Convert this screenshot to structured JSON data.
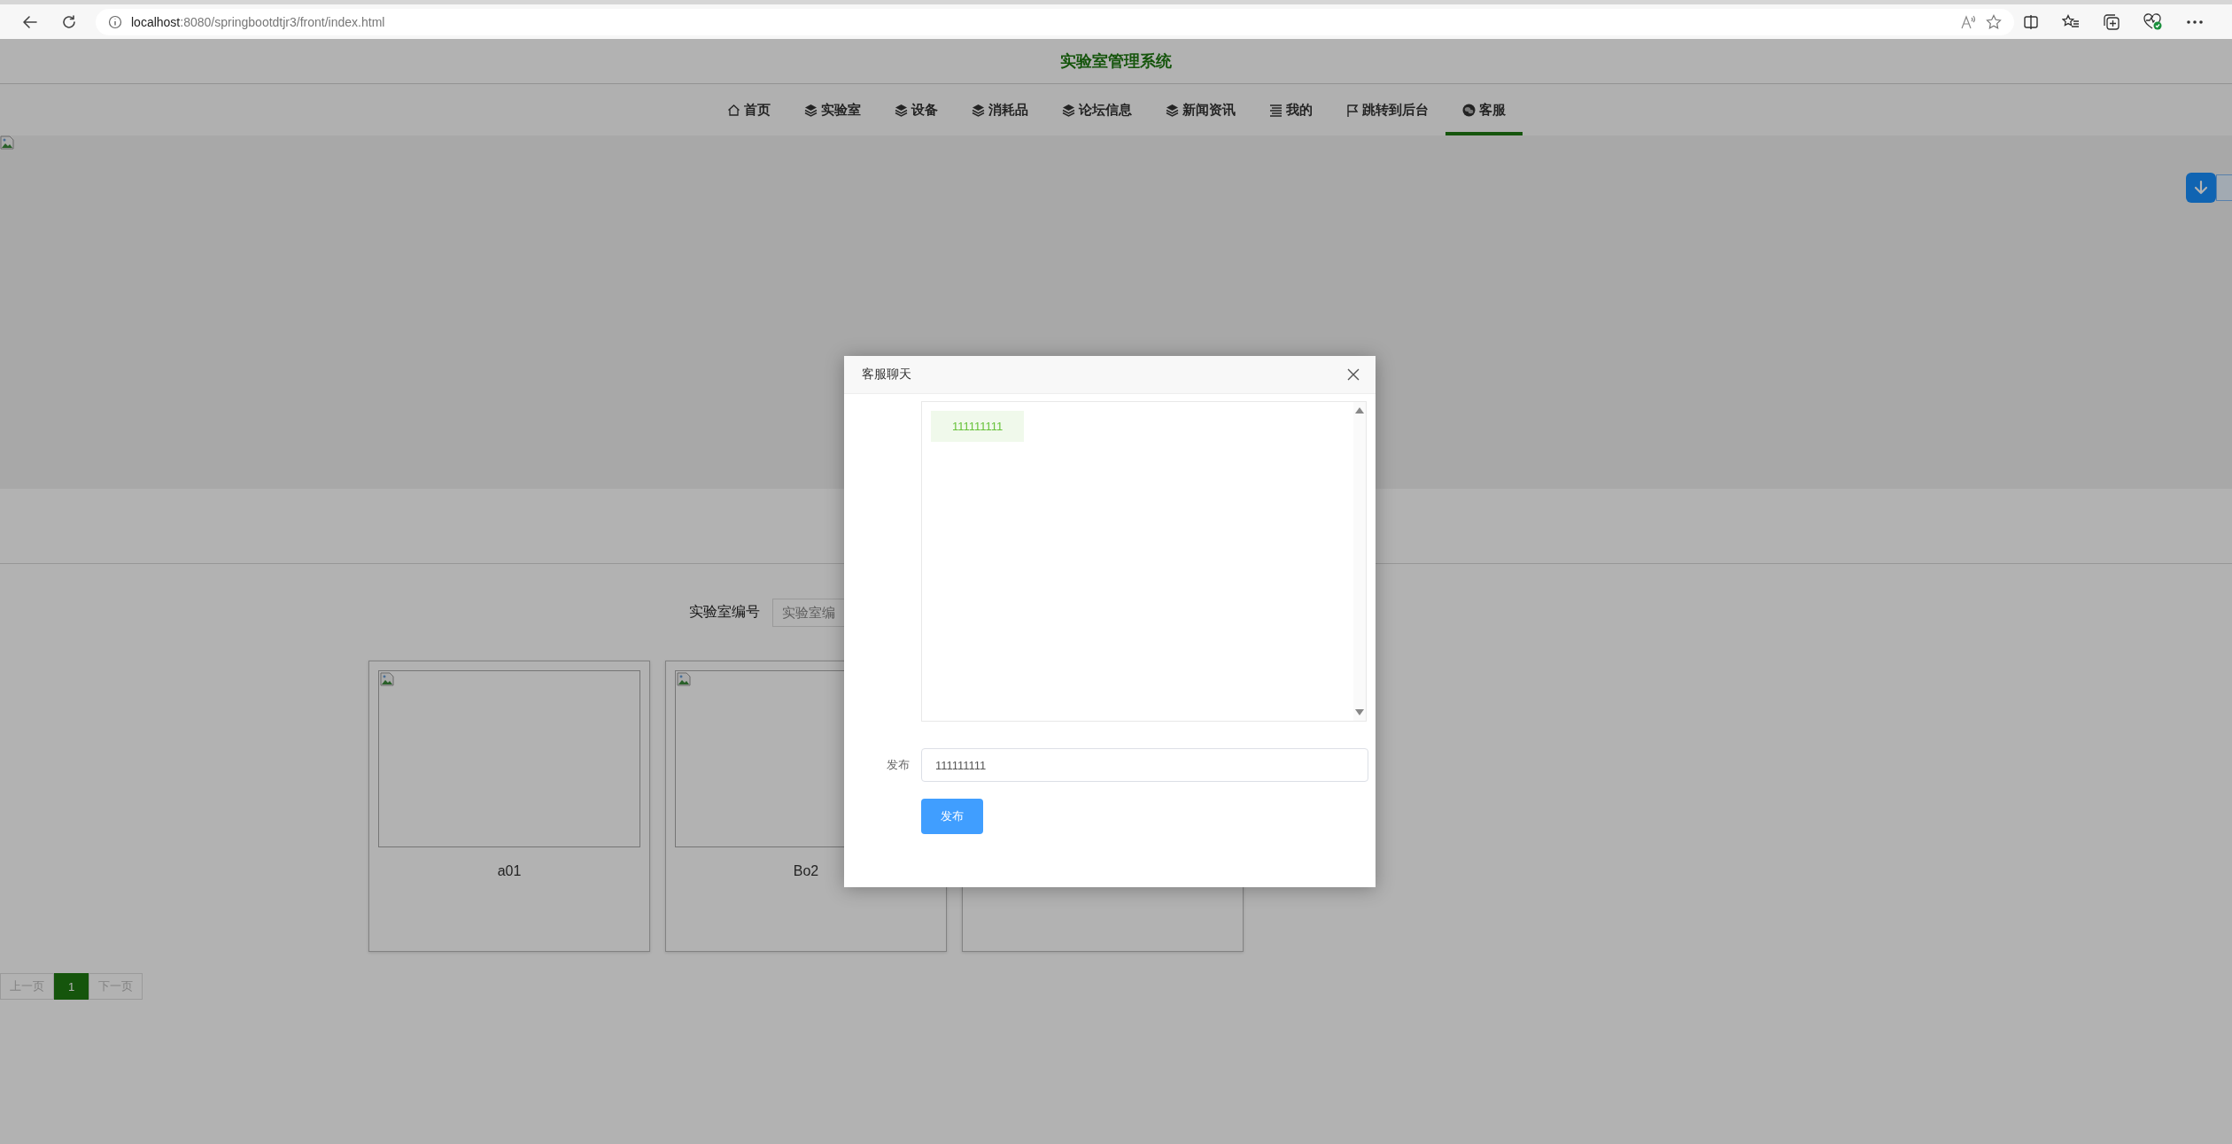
{
  "browser": {
    "url_host": "localhost",
    "url_rest": ":8080/springbootdtjr3/front/index.html"
  },
  "site": {
    "title": "实验室管理系统"
  },
  "nav": [
    {
      "label": "首页",
      "selected": false
    },
    {
      "label": "实验室",
      "selected": false
    },
    {
      "label": "设备",
      "selected": false
    },
    {
      "label": "消耗品",
      "selected": false
    },
    {
      "label": "论坛信息",
      "selected": false
    },
    {
      "label": "新闻资讯",
      "selected": false
    },
    {
      "label": "我的",
      "selected": false
    },
    {
      "label": "跳转到后台",
      "selected": false
    },
    {
      "label": "客服",
      "selected": true
    }
  ],
  "search": {
    "label": "实验室编号",
    "placeholder": "实验室编"
  },
  "cards": [
    {
      "kind": "titled",
      "name": "a01"
    },
    {
      "kind": "titled",
      "name": "Bo2"
    },
    {
      "kind": "untitled"
    }
  ],
  "pagination": {
    "prev": "上一页",
    "pages": [
      {
        "label": "1",
        "selected": true
      }
    ],
    "next": "下一页"
  },
  "dialog": {
    "title": "客服聊天",
    "messages": [
      {
        "text": "111111111"
      }
    ],
    "form_label": "发布",
    "value": "111111111",
    "button": "发布"
  }
}
